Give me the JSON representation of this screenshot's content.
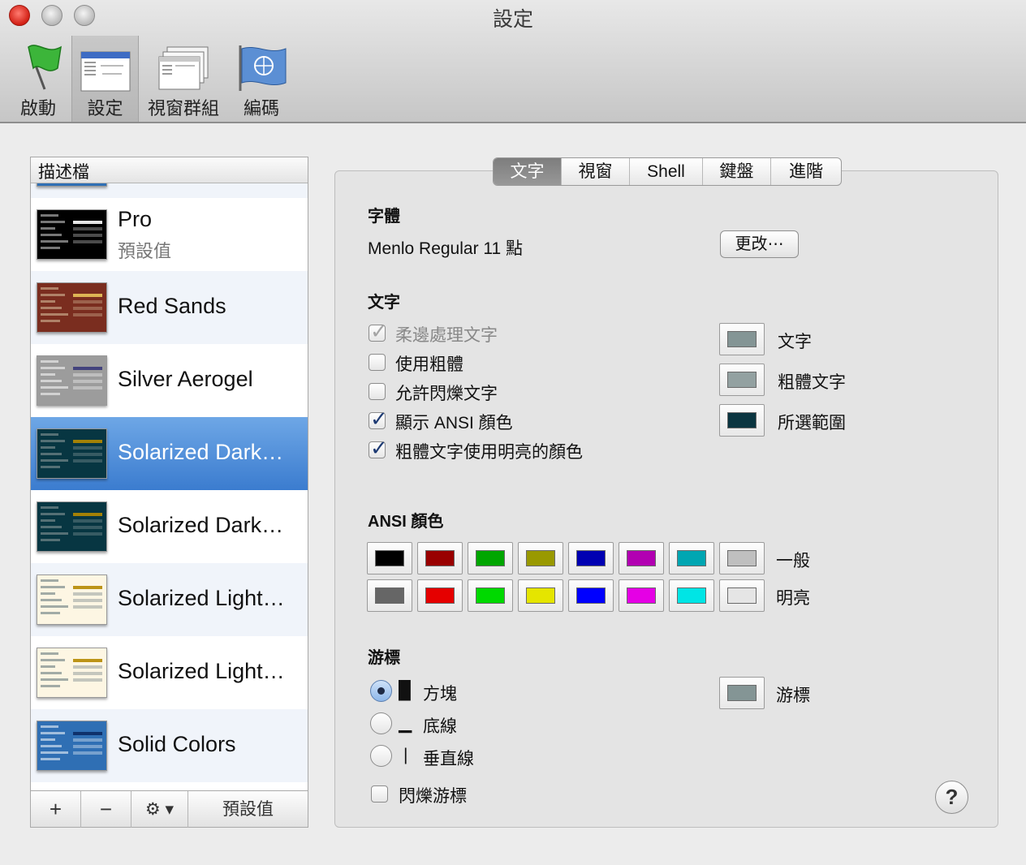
{
  "window": {
    "title": "設定"
  },
  "toolbar": [
    {
      "label": "啟動",
      "icon": "flag-icon"
    },
    {
      "label": "設定",
      "icon": "settings-window-icon",
      "selected": true
    },
    {
      "label": "視窗群組",
      "icon": "window-group-icon"
    },
    {
      "label": "編碼",
      "icon": "un-flag-icon"
    }
  ],
  "profiles": {
    "header": "描述檔",
    "default_label": "預設值",
    "items": [
      {
        "name": "Pro",
        "sub": "預設值",
        "bg": "#000000",
        "fg": "#d8d8d8",
        "hl": "#ffffff"
      },
      {
        "name": "Red Sands",
        "bg": "#7a2d1f",
        "fg": "#dcc7a4",
        "hl": "#e8c45a"
      },
      {
        "name": "Silver Aerogel",
        "bg": "#9c9c9c",
        "fg": "#ffffff",
        "hl": "#3a3a7a"
      },
      {
        "name": "Solarized Dark…",
        "bg": "#073642",
        "fg": "#93a1a1",
        "hl": "#b58900",
        "selected": true
      },
      {
        "name": "Solarized Dark…",
        "bg": "#073642",
        "fg": "#93a1a1",
        "hl": "#b58900"
      },
      {
        "name": "Solarized Light…",
        "bg": "#fdf6e3",
        "fg": "#586e75",
        "hl": "#b58900"
      },
      {
        "name": "Solarized Light…",
        "bg": "#fdf6e3",
        "fg": "#586e75",
        "hl": "#b58900"
      },
      {
        "name": "Solid Colors",
        "bg": "#2f6fb4",
        "fg": "#ffffff",
        "hl": "#0c2a63"
      }
    ],
    "footer": {
      "add": "+",
      "remove": "−",
      "gear": "⚙ ▾",
      "default": "預設值"
    }
  },
  "tabs": [
    "文字",
    "視窗",
    "Shell",
    "鍵盤",
    "進階"
  ],
  "active_tab": "文字",
  "font": {
    "heading": "字體",
    "value": "Menlo Regular 11 點",
    "change_button": "更改⋯"
  },
  "text": {
    "heading": "文字",
    "options": [
      {
        "label": "柔邊處理文字",
        "checked": true,
        "disabled": true
      },
      {
        "label": "使用粗體",
        "checked": false
      },
      {
        "label": "允許閃爍文字",
        "checked": false
      },
      {
        "label": "顯示 ANSI 顏色",
        "checked": true
      },
      {
        "label": "粗體文字使用明亮的顏色",
        "checked": true
      }
    ],
    "colors": [
      {
        "label": "文字",
        "color": "#849595"
      },
      {
        "label": "粗體文字",
        "color": "#93a1a1"
      },
      {
        "label": "所選範圍",
        "color": "#0a3540"
      }
    ]
  },
  "ansi": {
    "heading": "ANSI 顏色",
    "normal_label": "一般",
    "bright_label": "明亮",
    "normal": [
      "#000000",
      "#990000",
      "#00a600",
      "#999900",
      "#0000b2",
      "#b200b2",
      "#00a6b2",
      "#bfbfbf"
    ],
    "bright": [
      "#666666",
      "#e50000",
      "#00d900",
      "#e5e500",
      "#0000ff",
      "#e500e5",
      "#00e5e5",
      "#e5e5e5"
    ]
  },
  "cursor": {
    "heading": "游標",
    "styles": [
      {
        "glyph": "█",
        "label": "方塊",
        "selected": true
      },
      {
        "glyph": "▁",
        "label": "底線",
        "selected": false
      },
      {
        "glyph": "|",
        "label": "垂直線",
        "selected": false
      }
    ],
    "blink": {
      "label": "閃爍游標",
      "checked": false
    },
    "color": {
      "label": "游標",
      "color": "#849595"
    }
  },
  "help_label": "?"
}
